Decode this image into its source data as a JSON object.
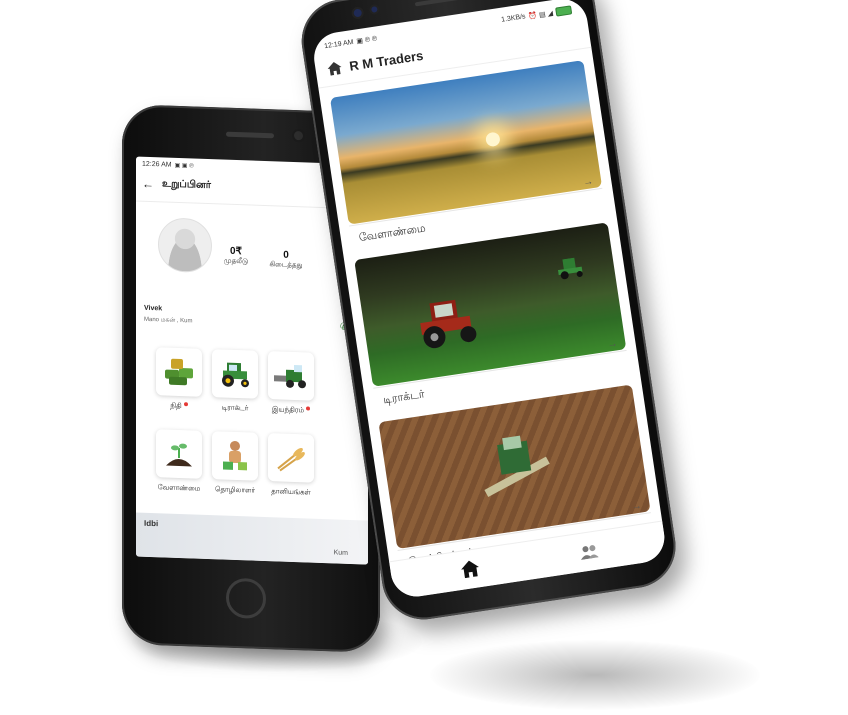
{
  "back_phone": {
    "status_time": "12:26 AM",
    "header_title": "உறுப்பினர்",
    "stats": [
      {
        "value": "0₹",
        "label": "முதலீடு"
      },
      {
        "value": "0",
        "label": "கிடைத்தது"
      }
    ],
    "user_name": "Vivek",
    "user_location": "Mano மகன் ,  Kum",
    "tiles": [
      {
        "label": "நிதி",
        "has_dot": true,
        "icon": "money-bundle-icon"
      },
      {
        "label": "டிராக்டர்",
        "has_dot": false,
        "icon": "tractor-icon"
      },
      {
        "label": "இயந்திரம்",
        "has_dot": true,
        "icon": "harvester-icon"
      },
      {
        "label": "வேளாண்மை",
        "has_dot": false,
        "icon": "seedling-soil-icon"
      },
      {
        "label": "தொழிலாளர்",
        "has_dot": false,
        "icon": "farmer-icon"
      },
      {
        "label": "தானியங்கள்",
        "has_dot": false,
        "icon": "wheat-icon"
      }
    ],
    "banner_title": "Idbi",
    "banner_sub": "Kum"
  },
  "front_phone": {
    "status_time": "12:19 AM",
    "status_speed": "1.3KB/s",
    "app_title": "R M Traders",
    "cards": [
      {
        "label": "வேளாண்மை",
        "image": "sunset-field"
      },
      {
        "label": "டிராக்டர்",
        "image": "tractor-field"
      },
      {
        "label": "இயந்திரங்கள்",
        "image": "harvester-aerial"
      }
    ],
    "nav": [
      "home-icon",
      "people-icon"
    ]
  },
  "colors": {
    "accent_green": "#2e7d32",
    "dot_red": "#e53935",
    "text_dark": "#222222"
  }
}
